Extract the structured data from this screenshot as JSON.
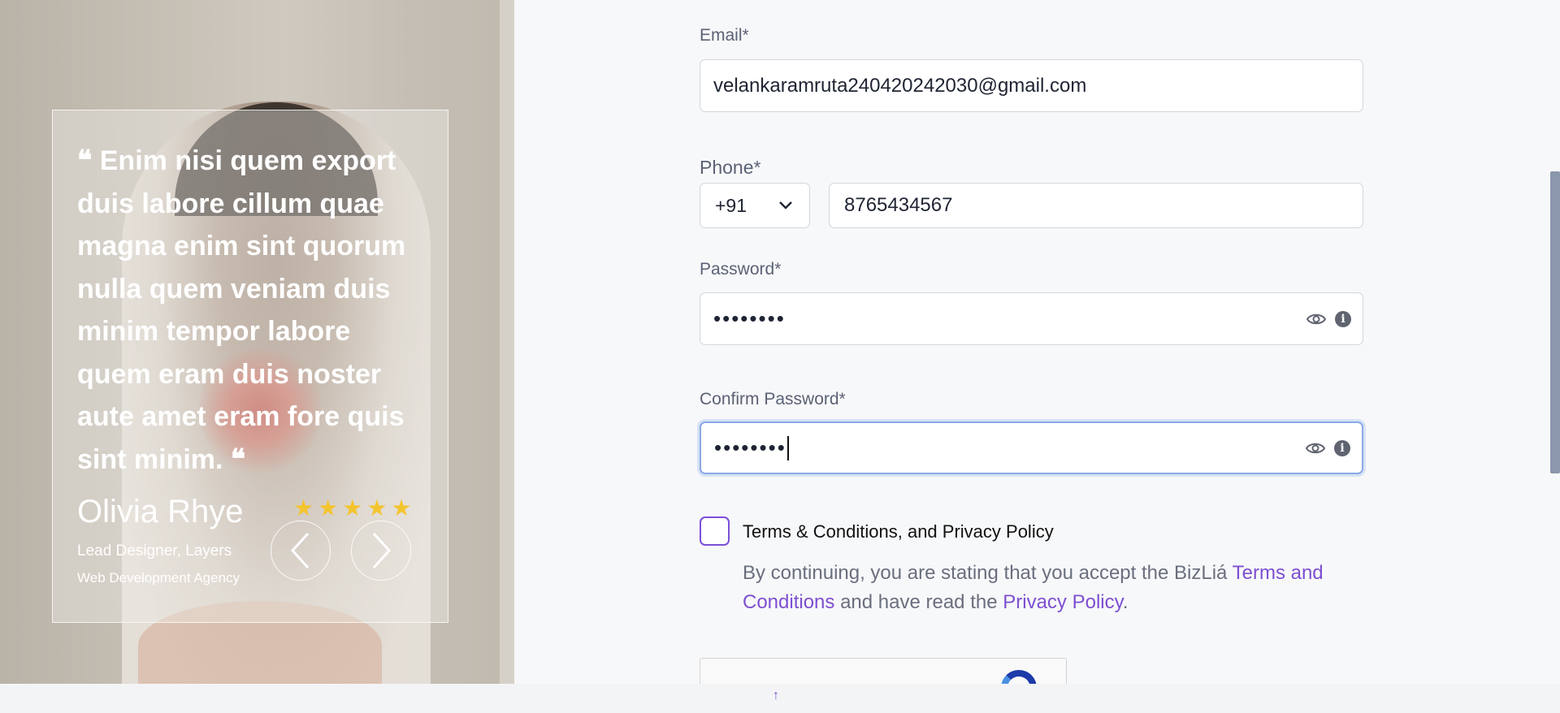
{
  "testimonial": {
    "quote": "Enim nisi quem export duis labore cillum quae magna enim sint quorum nulla quem veniam duis minim tempor labore quem eram duis noster aute amet eram fore quis sint minim.",
    "author": "Olivia Rhye",
    "role": "Lead Designer, Layers",
    "company": "Web Development Agency",
    "rating": 5,
    "star_color": "#f4c430"
  },
  "form": {
    "email": {
      "label": "Email*",
      "value": "velankaramruta240420242030@gmail.com"
    },
    "phone": {
      "label": "Phone*",
      "country_code": "+91",
      "value": "8765434567"
    },
    "password": {
      "label": "Password*",
      "masked_value": "••••••••"
    },
    "confirm_password": {
      "label": "Confirm Password*",
      "masked_value": "••••••••"
    },
    "terms": {
      "checkbox_label": "Terms & Conditions, and Privacy Policy",
      "checked": false,
      "consent_prefix": "By continuing, you are stating that you accept the BizLiá ",
      "terms_link": "Terms and Conditions",
      "consent_middle": " and have read the ",
      "privacy_link": "Privacy Policy",
      "consent_suffix": "."
    }
  },
  "colors": {
    "accent": "#7d4fd1",
    "focus_ring": "#8aa9e6",
    "text": "#1f2433",
    "muted": "#5b6274"
  },
  "icons": {
    "prev": "chevron-left-icon",
    "next": "chevron-right-icon",
    "show_password": "eye-icon",
    "info": "info-icon",
    "dropdown": "chevron-down-icon",
    "scroll_top": "arrow-up-icon"
  }
}
